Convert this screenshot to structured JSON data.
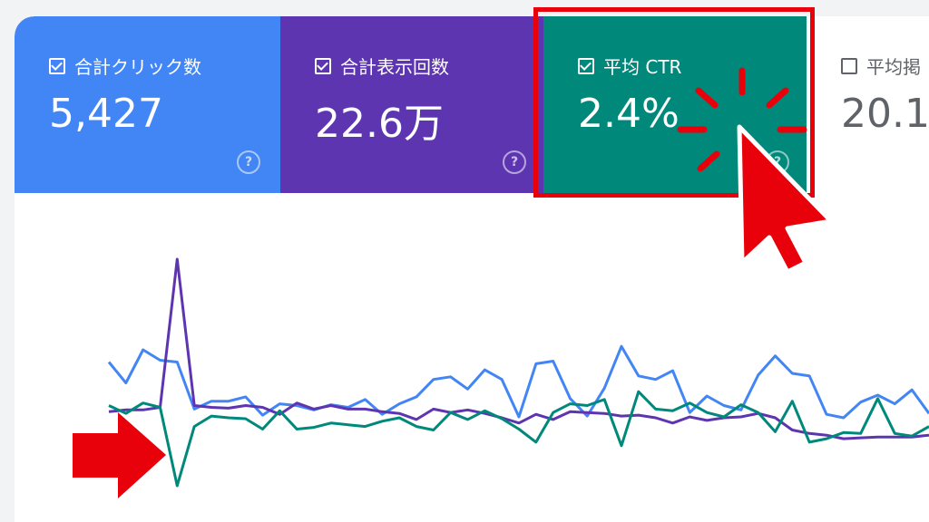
{
  "cards": {
    "clicks": {
      "label": "合計クリック数",
      "value": "5,427",
      "color": "#4285f4",
      "checked": true,
      "help": "?"
    },
    "impressions": {
      "label": "合計表示回数",
      "value": "22.6万",
      "color": "#5e35b1",
      "checked": true,
      "help": "?"
    },
    "ctr": {
      "label": "平均 CTR",
      "value": "2.4%",
      "color": "#00897b",
      "checked": true,
      "help": "?"
    },
    "position": {
      "label": "平均掲",
      "value": "20.1",
      "checked": false
    }
  },
  "chart_data": {
    "type": "line",
    "series": [
      {
        "color": "#4285f4",
        "values": [
          72,
          48,
          86,
          74,
          72,
          18,
          27,
          27,
          32,
          11,
          24,
          22,
          17,
          23,
          20,
          29,
          12,
          24,
          32,
          52,
          55,
          41,
          63,
          52,
          9,
          70,
          73,
          30,
          10,
          42,
          90,
          56,
          52,
          62,
          14,
          33,
          22,
          17,
          57,
          79,
          59,
          56,
          12,
          8,
          26,
          34,
          24,
          40,
          13
        ]
      },
      {
        "color": "#5e35b1",
        "values": [
          15,
          17,
          17,
          20,
          190,
          22,
          20,
          19,
          22,
          20,
          12,
          25,
          18,
          22,
          18,
          18,
          15,
          13,
          6,
          18,
          14,
          17,
          13,
          8,
          2,
          12,
          6,
          15,
          14,
          13,
          10,
          11,
          8,
          2,
          9,
          5,
          8,
          9,
          13,
          8,
          -6,
          -10,
          -12,
          -16,
          -15,
          -14,
          -14,
          -14,
          -12
        ]
      },
      {
        "color": "#00897b",
        "values": [
          22,
          13,
          25,
          20,
          -70,
          -2,
          10,
          8,
          7,
          -5,
          16,
          -5,
          -3,
          2,
          0,
          -2,
          4,
          8,
          -2,
          -6,
          14,
          6,
          16,
          7,
          -5,
          -20,
          14,
          24,
          22,
          29,
          -24,
          38,
          18,
          16,
          25,
          14,
          9,
          23,
          14,
          -8,
          27,
          -20,
          -16,
          -9,
          -10,
          30,
          -10,
          -13,
          -2
        ]
      }
    ]
  }
}
